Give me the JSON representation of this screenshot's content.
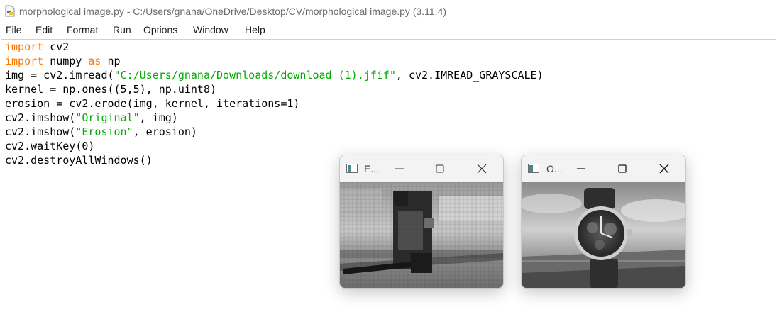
{
  "window": {
    "title": "morphological image.py - C:/Users/gnana/OneDrive/Desktop/CV/morphological image.py (3.11.4)"
  },
  "menu": [
    "File",
    "Edit",
    "Format",
    "Run",
    "Options",
    "Window",
    "Help"
  ],
  "code": [
    {
      "kw": "import",
      "rest": " cv2"
    },
    {
      "kw": "import",
      "mid": " numpy ",
      "kw2": "as",
      "rest2": " np"
    },
    {
      "pre": "img = cv2.imread(",
      "str": "\"C:/Users/gnana/Downloads/download (1).jfif\"",
      "post": ", cv2.IMREAD_GRAYSCALE)"
    },
    {
      "text": "kernel = np.ones((5,5), np.uint8)"
    },
    {
      "text": "erosion = cv2.erode(img, kernel, iterations=1)"
    },
    {
      "pre": "cv2.imshow(",
      "str": "\"Original\"",
      "post": ", img)"
    },
    {
      "pre": "cv2.imshow(",
      "str": "\"Erosion\"",
      "post": ", erosion)"
    },
    {
      "text": "cv2.waitKey(0)"
    },
    {
      "text": "cv2.destroyAllWindows()"
    }
  ],
  "erosion_window": {
    "title": "E..."
  },
  "original_window": {
    "title": "O..."
  },
  "colors": {
    "keyword": "#ff7700",
    "string": "#00aa00",
    "titlebar_text": "#6b6b6b"
  },
  "icons": [
    "python-file-icon",
    "opencv-window-icon",
    "minimize-icon",
    "maximize-icon",
    "close-icon"
  ]
}
